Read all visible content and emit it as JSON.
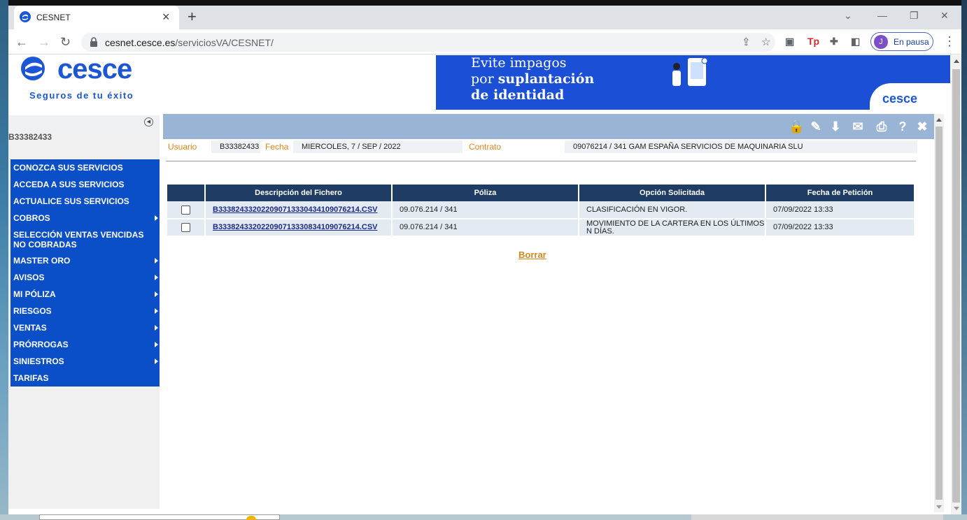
{
  "browser": {
    "tab_title": "CESNET",
    "url_host": "cesnet.cesce.es",
    "url_path": "/serviciosVA/CESNET/",
    "profile_initial": "J",
    "profile_label": "En pausa"
  },
  "header": {
    "logo_text": "cesce",
    "tagline": "Seguros de tu éxito",
    "banner_line1": "Evite impagos",
    "banner_line2_prefix": "por ",
    "banner_line2_bold": "suplantación",
    "banner_line3": "de identidad",
    "banner_brand": "cesce"
  },
  "sidebar": {
    "user_code": "B33382433",
    "items": [
      {
        "label": "CONOZCA SUS SERVICIOS",
        "has_submenu": false
      },
      {
        "label": "ACCEDA A SUS SERVICIOS",
        "has_submenu": false
      },
      {
        "label": "ACTUALICE SUS SERVICIOS",
        "has_submenu": false
      },
      {
        "label": "COBROS",
        "has_submenu": true
      },
      {
        "label": "SELECCIÓN VENTAS VENCIDAS NO COBRADAS",
        "has_submenu": false
      },
      {
        "label": "MASTER ORO",
        "has_submenu": true
      },
      {
        "label": "AVISOS",
        "has_submenu": true
      },
      {
        "label": "MI PÓLIZA",
        "has_submenu": true
      },
      {
        "label": "RIESGOS",
        "has_submenu": true
      },
      {
        "label": "VENTAS",
        "has_submenu": true
      },
      {
        "label": "PRÓRROGAS",
        "has_submenu": true
      },
      {
        "label": "SINIESTROS",
        "has_submenu": true
      },
      {
        "label": "TARIFAS",
        "has_submenu": false
      }
    ]
  },
  "info": {
    "usuario_label": "Usuario",
    "usuario_value": "B33382433",
    "fecha_label": "Fecha",
    "fecha_value": "MIERCOLES, 7 / SEP / 2022",
    "contrato_label": "Contrato",
    "contrato_value": "09076214 / 341 GAM ESPAÑA SERVICIOS DE MAQUINARIA SLU"
  },
  "table": {
    "headers": [
      "Descripción del Fichero",
      "Póliza",
      "Opción Solicitada",
      "Fecha de Petición"
    ],
    "rows": [
      {
        "checked": false,
        "file": "B333824332022090713330434109076214.CSV",
        "poliza": "09.076.214 / 341",
        "opcion": "CLASIFICACIÓN EN VIGOR.",
        "fecha": "07/09/2022 13:33"
      },
      {
        "checked": false,
        "file": "B333824332022090713330834109076214.CSV",
        "poliza": "09.076.214 / 341",
        "opcion": "MOVIMIENTO DE LA CARTERA EN LOS ÚLTIMOS N DÍAS.",
        "fecha": "07/09/2022 13:33"
      }
    ]
  },
  "actions": {
    "borrar": "Borrar"
  }
}
